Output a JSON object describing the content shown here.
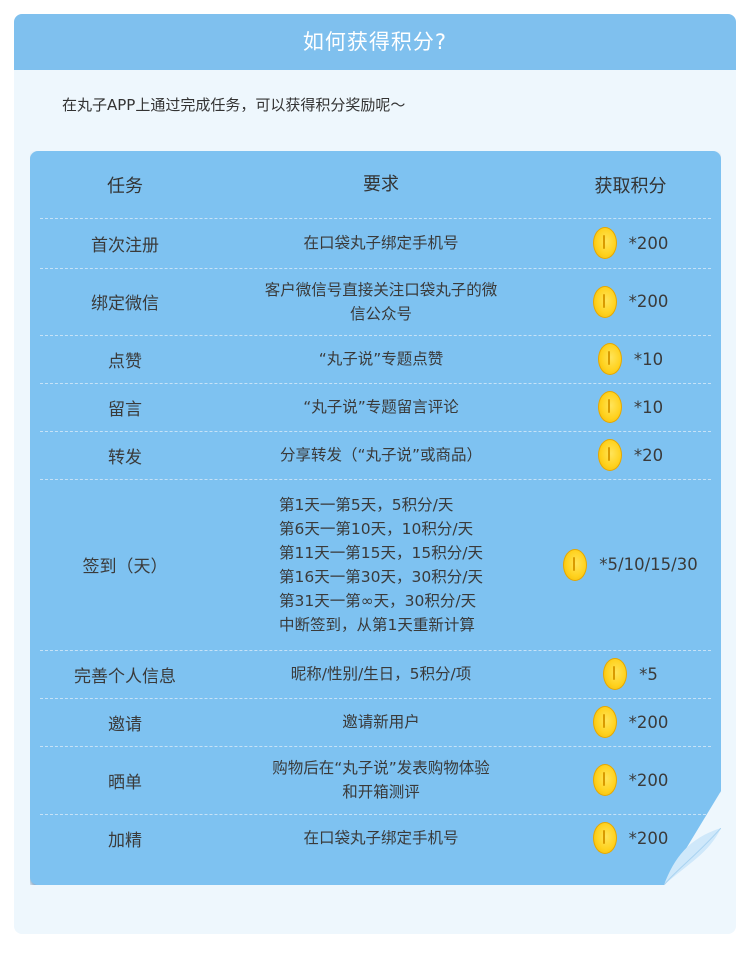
{
  "header": {
    "title": "如何获得积分?"
  },
  "intro": "在丸子APP上通过完成任务，可以获得积分奖励呢～",
  "table": {
    "headers": [
      "任务",
      "要求",
      "获取积分"
    ],
    "rows": [
      {
        "task": "首次注册",
        "req": [
          "在口袋丸子绑定手机号"
        ],
        "points": "*200"
      },
      {
        "task": "绑定微信",
        "req": [
          "客户微信号直接关注口袋丸子的微",
          "信公众号"
        ],
        "points": "*200"
      },
      {
        "task": "点赞",
        "req": [
          "“丸子说”专题点赞"
        ],
        "points": "*10"
      },
      {
        "task": "留言",
        "req": [
          "“丸子说”专题留言评论"
        ],
        "points": "*10"
      },
      {
        "task": "转发",
        "req": [
          "分享转发（“丸子说”或商品）"
        ],
        "points": "*20"
      },
      {
        "task": "签到（天）",
        "req": [
          "第1天一第5天，5积分/天",
          "第6天一第10天，10积分/天",
          "第11天一第15天，15积分/天",
          "第16天一第30天，30积分/天",
          "第31天一第∞天，30积分/天",
          "中断签到，从第1天重新计算"
        ],
        "points": "*5/10/15/30"
      },
      {
        "task": "完善个人信息",
        "req": [
          "昵称/性别/生日，5积分/项"
        ],
        "points": "*5"
      },
      {
        "task": "邀请",
        "req": [
          "邀请新用户"
        ],
        "points": "*200"
      },
      {
        "task": "晒单",
        "req": [
          "购物后在“丸子说”发表购物体验",
          "和开箱测评"
        ],
        "points": "*200"
      },
      {
        "task": "加精",
        "req": [
          "在口袋丸子绑定手机号"
        ],
        "points": "*200"
      }
    ]
  },
  "colors": {
    "header_bg": "#7fc0ee",
    "card_bg": "#7ec2f1",
    "panel_bg": "#eef7fd",
    "coin": "#ffd21f"
  },
  "icons": {
    "coin": "gold-coin-icon"
  }
}
